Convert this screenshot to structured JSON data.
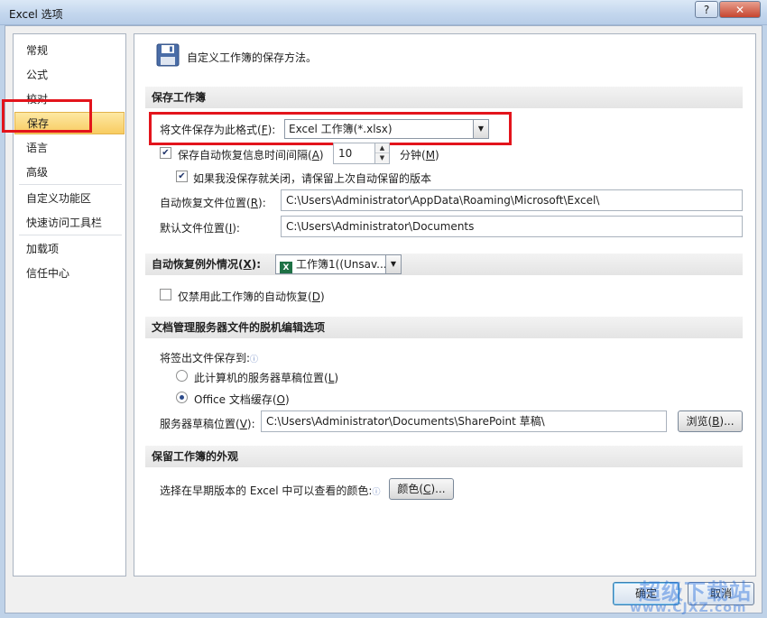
{
  "window": {
    "title": "Excel 选项",
    "help_label": "?",
    "close_label": "✕"
  },
  "nav": {
    "items": [
      {
        "label": "常规"
      },
      {
        "label": "公式"
      },
      {
        "label": "校对"
      },
      {
        "label": "保存",
        "selected": true
      },
      {
        "label": "语言"
      },
      {
        "label": "高级"
      },
      {
        "label": "自定义功能区"
      },
      {
        "label": "快速访问工具栏"
      },
      {
        "label": "加载项"
      },
      {
        "label": "信任中心"
      }
    ]
  },
  "panel": {
    "header_text": "自定义工作簿的保存方法。",
    "header_icon": "floppy-disk-icon",
    "save_section": {
      "title": "保存工作簿",
      "format_label": "将文件保存为此格式(",
      "format_key": "F",
      "format_label_end": "):",
      "format_value": "Excel 工作簿(*.xlsx)",
      "autorecover_label": "保存自动恢复信息时间间隔(",
      "autorecover_key": "A",
      "autorecover_label_end": ")",
      "autorecover_checked": true,
      "autorecover_minutes": "10",
      "minutes_label": "分钟(",
      "minutes_key": "M",
      "minutes_label_end": ")",
      "keep_last_label": "如果我没保存就关闭，请保留上次自动保留的版本",
      "keep_last_checked": true,
      "autorecover_location_label": "自动恢复文件位置(",
      "autorecover_location_key": "R",
      "autorecover_location_label_end": "):",
      "autorecover_location_value": "C:\\Users\\Administrator\\AppData\\Roaming\\Microsoft\\Excel\\",
      "default_location_label": "默认文件位置(",
      "default_location_key": "I",
      "default_location_label_end": "):",
      "default_location_value": "C:\\Users\\Administrator\\Documents"
    },
    "exceptions_section": {
      "title": "自动恢复例外情况(",
      "title_key": "X",
      "title_end": "):",
      "workbook_value": "工作簿1((Unsav...",
      "workbook_icon_letter": "X",
      "disable_label": "仅禁用此工作簿的自动恢复(",
      "disable_key": "D",
      "disable_label_end": ")",
      "disable_checked": false
    },
    "offline_section": {
      "title": "文档管理服务器文件的脱机编辑选项",
      "checkout_label": "将签出文件保存到:",
      "info_glyph": "ⓘ",
      "radio1_label": "此计算机的服务器草稿位置(",
      "radio1_key": "L",
      "radio1_label_end": ")",
      "radio1_selected": false,
      "radio2_label": "Office 文档缓存(",
      "radio2_key": "O",
      "radio2_label_end": ")",
      "radio2_selected": true,
      "drafts_label": "服务器草稿位置(",
      "drafts_key": "V",
      "drafts_label_end": "):",
      "drafts_value": "C:\\Users\\Administrator\\Documents\\SharePoint 草稿\\",
      "browse_label": "浏览(",
      "browse_key": "B",
      "browse_label_end": ")..."
    },
    "appearance_section": {
      "title": "保留工作簿的外观",
      "colors_label": "选择在早期版本的 Excel 中可以查看的颜色:",
      "info_glyph": "ⓘ",
      "colors_button": "颜色(",
      "colors_key": "C",
      "colors_button_end": ")..."
    }
  },
  "footer": {
    "ok_label": "确定",
    "cancel_label": "取消"
  },
  "watermark": {
    "line1": "超级下载站",
    "line2": "www.CJXZ.com"
  },
  "colors": {
    "selected_nav": "#f8cc61",
    "annotation_red": "#e3141c",
    "section_bar": "#e4e4e4"
  }
}
